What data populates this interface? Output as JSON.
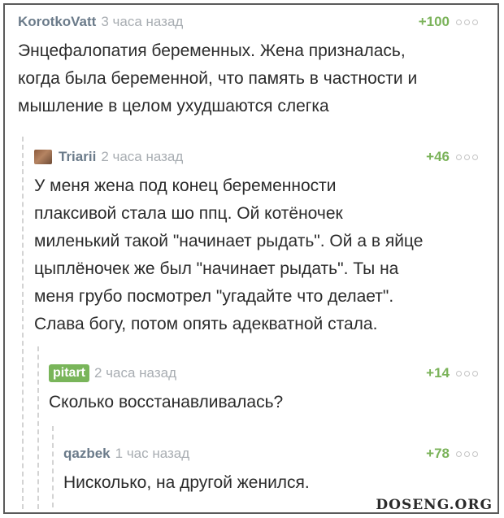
{
  "comments": [
    {
      "author": "KorotkoVatt",
      "time": "3 часа назад",
      "rating": "+100",
      "text": "Энцефалопатия беременных. Жена призналась,\nкогда была беременной, что память в частности и\nмышление в целом ухудшаются слегка"
    },
    {
      "author": "Triarii",
      "time": "2 часа назад",
      "rating": "+46",
      "text": "У меня жена под конец беременности\nплаксивой стала шо ппц. Ой котёночек\nмиленький такой \"начинает рыдать\". Ой а в яйце\nцыплёночек же был \"начинает рыдать\". Ты на\nменя грубо посмотрел \"угадайте что делает\".\nСлава богу, потом опять адекватной стала."
    },
    {
      "author": "pitart",
      "time": "2 часа назад",
      "rating": "+14",
      "text": "Сколько восстанавливалась?"
    },
    {
      "author": "qazbek",
      "time": "1 час назад",
      "rating": "+78",
      "text": "Нисколько, на другой женился."
    }
  ],
  "watermark": "DOSENG.ORG"
}
